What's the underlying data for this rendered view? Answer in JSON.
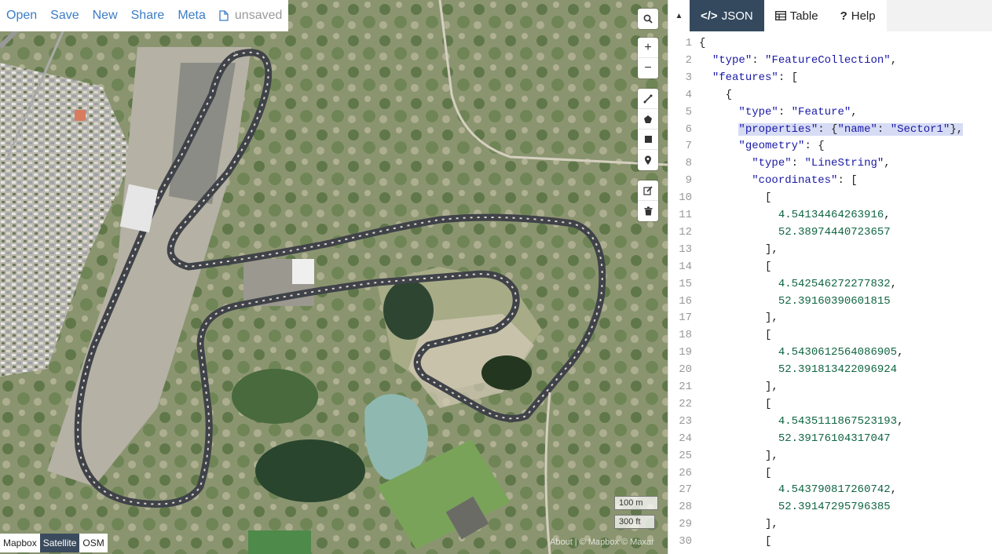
{
  "menu": {
    "open": "Open",
    "save": "Save",
    "new": "New",
    "share": "Share",
    "meta": "Meta",
    "file_status": "unsaved"
  },
  "map_controls": {
    "search_icon": "search-icon",
    "zoom_in": "+",
    "zoom_out": "−",
    "draw_tools": [
      "draw-line-icon",
      "draw-polygon-icon",
      "draw-rectangle-icon",
      "draw-marker-icon"
    ],
    "edit_tools": [
      "edit-icon",
      "delete-icon"
    ]
  },
  "scale": {
    "metric": "100 m",
    "imperial": "300 ft"
  },
  "layers": [
    "Mapbox",
    "Satellite",
    "OSM"
  ],
  "active_layer": "Satellite",
  "attribution": "About | © Mapbox © Maxar",
  "panel": {
    "tabs": [
      {
        "label": "JSON",
        "icon": "code-icon",
        "active": true
      },
      {
        "label": "Table",
        "icon": "table-icon",
        "active": false
      },
      {
        "label": "Help",
        "icon": "help-icon",
        "active": false
      }
    ]
  },
  "editor": {
    "highlighted_line": 6,
    "lines": [
      "{",
      "  \"type\": \"FeatureCollection\",",
      "  \"features\": [",
      "    {",
      "      \"type\": \"Feature\",",
      "      \"properties\": {\"name\": \"Sector1\"},",
      "      \"geometry\": {",
      "        \"type\": \"LineString\",",
      "        \"coordinates\": [",
      "          [",
      "            4.54134464263916,",
      "            52.38974440723657",
      "          ],",
      "          [",
      "            4.542546272277832,",
      "            52.39160390601815",
      "          ],",
      "          [",
      "            4.5430612564086905,",
      "            52.391813422096924",
      "          ],",
      "          [",
      "            4.5435111867523193,",
      "            52.39176104317047",
      "          ],",
      "          [",
      "            4.543790817260742,",
      "            52.39147295796385",
      "          ],",
      "          ["
    ]
  }
}
